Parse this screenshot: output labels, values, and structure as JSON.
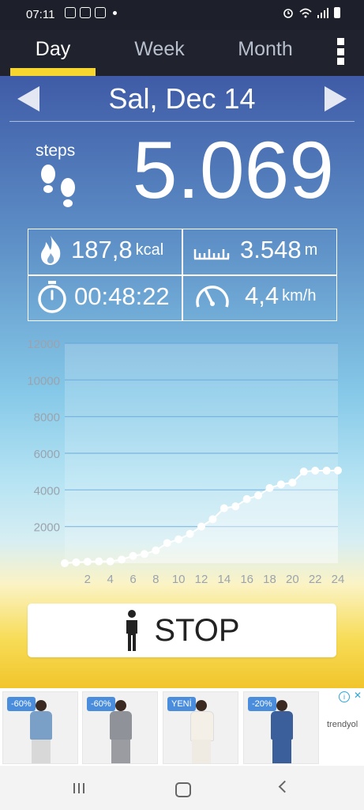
{
  "status_bar": {
    "time": "07:11"
  },
  "tabs": [
    {
      "label": "Day",
      "active": true
    },
    {
      "label": "Week",
      "active": false
    },
    {
      "label": "Month",
      "active": false
    }
  ],
  "date": "Sal, Dec 14",
  "steps": {
    "label": "steps",
    "value": "5.069"
  },
  "stats": {
    "calories": {
      "value": "187,8",
      "unit": "kcal"
    },
    "distance": {
      "value": "3.548",
      "unit": "m"
    },
    "time": {
      "value": "00:48:22"
    },
    "speed": {
      "value": "4,4",
      "unit": "km/h"
    }
  },
  "chart_data": {
    "type": "area",
    "x": [
      0,
      1,
      2,
      3,
      4,
      5,
      6,
      7,
      8,
      9,
      10,
      11,
      12,
      13,
      14,
      15,
      16,
      17,
      18,
      19,
      20,
      21,
      22,
      23,
      24
    ],
    "values": [
      0,
      50,
      80,
      100,
      100,
      200,
      400,
      500,
      700,
      1100,
      1300,
      1600,
      2000,
      2400,
      3000,
      3100,
      3500,
      3700,
      4100,
      4300,
      4400,
      5000,
      5050,
      5050,
      5060
    ],
    "x_ticks": [
      "2",
      "4",
      "6",
      "8",
      "10",
      "12",
      "14",
      "16",
      "18",
      "20",
      "22",
      "24"
    ],
    "y_ticks": [
      "2000",
      "4000",
      "6000",
      "8000",
      "10000",
      "12000"
    ],
    "xlim": [
      0,
      24
    ],
    "ylim": [
      0,
      12000
    ],
    "grid": true,
    "colors": {
      "line": "#ffffff",
      "fill": "#ffffff",
      "grid": "#5fa3d8",
      "tick": "#9aa3ae"
    }
  },
  "stop_button": {
    "label": "STOP"
  },
  "ads": {
    "items": [
      {
        "badge": "-60%",
        "color": "#7aa0c8"
      },
      {
        "badge": "-60%",
        "color": "#8f9298"
      },
      {
        "badge": "YENİ",
        "color": "#f4f0e8"
      },
      {
        "badge": "-20%",
        "color": "#3a5f9a"
      }
    ],
    "brand": "trendyol"
  },
  "colors": {
    "accent": "#f7d72f",
    "tabbar": "#20222e",
    "statusbar": "#1d1f2a"
  }
}
